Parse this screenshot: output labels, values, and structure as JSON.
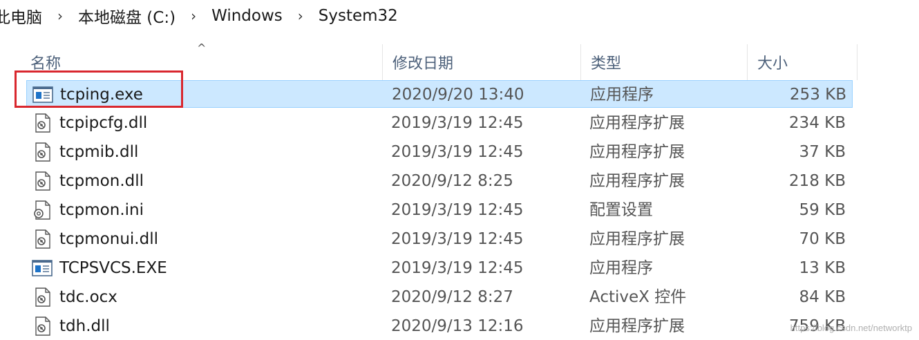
{
  "breadcrumb": [
    {
      "label": "此电脑"
    },
    {
      "label": "本地磁盘 (C:)"
    },
    {
      "label": "Windows"
    },
    {
      "label": "System32"
    }
  ],
  "breadcrumb_separator": "›",
  "columns": {
    "name": "名称",
    "date": "修改日期",
    "type": "类型",
    "size": "大小"
  },
  "sort_indicator": "^",
  "files": [
    {
      "name": "tcping.exe",
      "date": "2020/9/20 13:40",
      "type": "应用程序",
      "size": "253 KB",
      "icon": "exe-icon",
      "selected": true
    },
    {
      "name": "tcpipcfg.dll",
      "date": "2019/3/19 12:45",
      "type": "应用程序扩展",
      "size": "234 KB",
      "icon": "dll-icon"
    },
    {
      "name": "tcpmib.dll",
      "date": "2019/3/19 12:45",
      "type": "应用程序扩展",
      "size": "37 KB",
      "icon": "dll-icon"
    },
    {
      "name": "tcpmon.dll",
      "date": "2020/9/12 8:25",
      "type": "应用程序扩展",
      "size": "218 KB",
      "icon": "dll-icon"
    },
    {
      "name": "tcpmon.ini",
      "date": "2019/3/19 12:45",
      "type": "配置设置",
      "size": "59 KB",
      "icon": "ini-icon"
    },
    {
      "name": "tcpmonui.dll",
      "date": "2019/3/19 12:45",
      "type": "应用程序扩展",
      "size": "70 KB",
      "icon": "dll-icon"
    },
    {
      "name": "TCPSVCS.EXE",
      "date": "2019/3/19 12:45",
      "type": "应用程序",
      "size": "13 KB",
      "icon": "exe-icon"
    },
    {
      "name": "tdc.ocx",
      "date": "2020/9/12 8:27",
      "type": "ActiveX 控件",
      "size": "84 KB",
      "icon": "dll-icon"
    },
    {
      "name": "tdh.dll",
      "date": "2020/9/13 12:16",
      "type": "应用程序扩展",
      "size": "759 KB",
      "icon": "dll-icon"
    }
  ],
  "watermark": "https://blog.csdn.net/networktp",
  "colors": {
    "selection_bg": "#cce8ff",
    "selection_border": "#99d1ff",
    "highlight_box": "#d9272e",
    "header_text": "#4c607a"
  }
}
